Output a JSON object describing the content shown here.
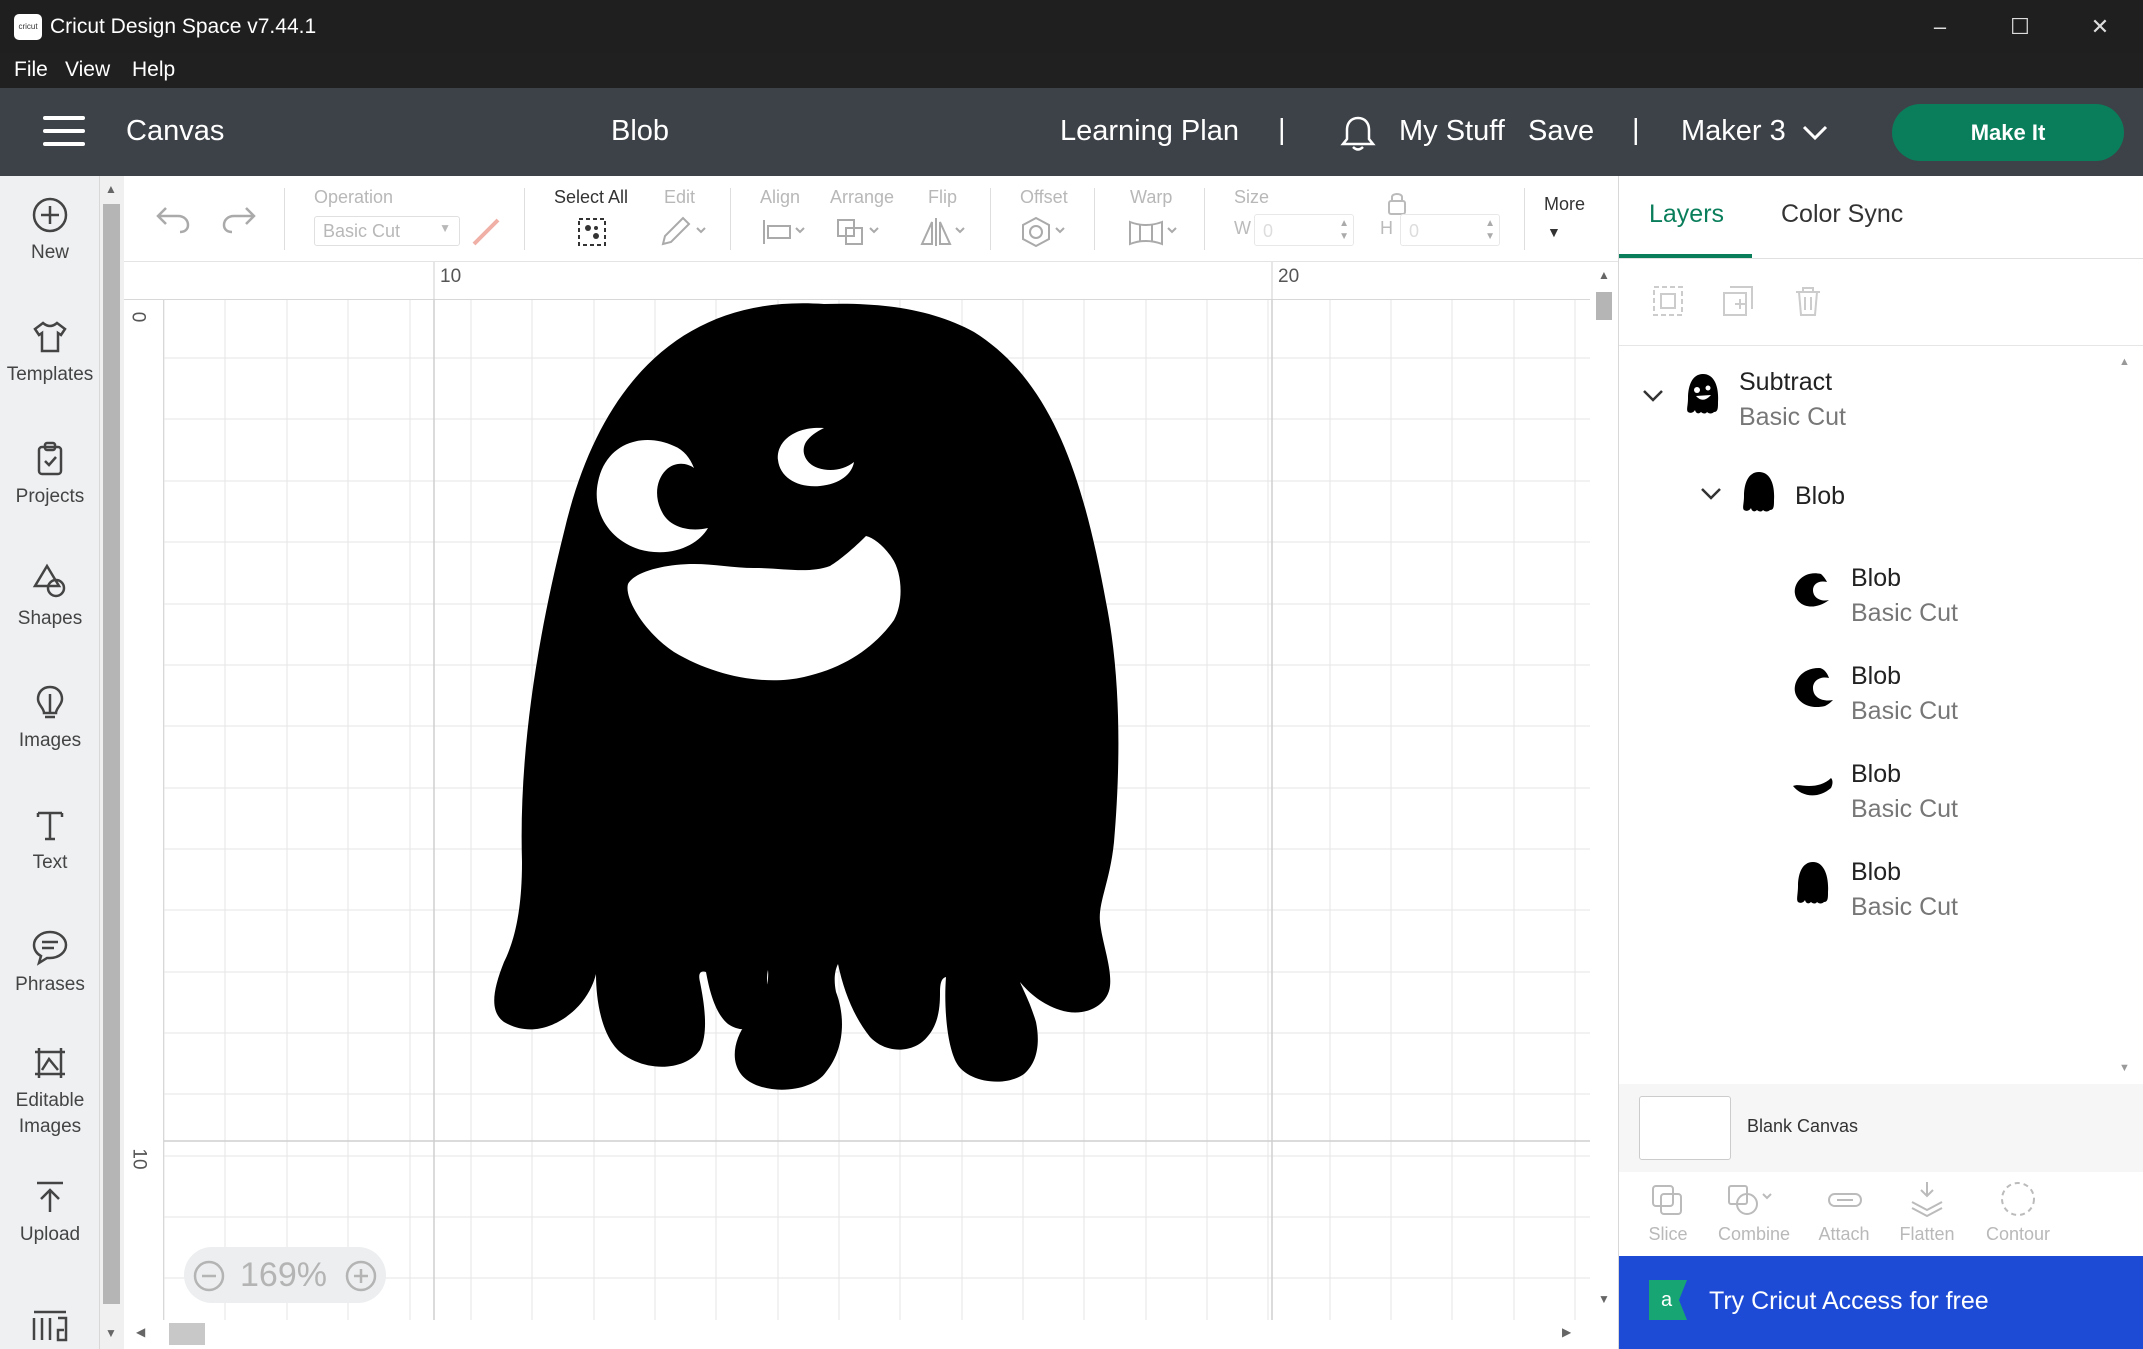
{
  "app": {
    "title": "Cricut Design Space  v7.44.1",
    "logo_text": "cricut"
  },
  "menu": {
    "items": [
      "File",
      "View",
      "Help"
    ]
  },
  "header": {
    "canvas_label": "Canvas",
    "project_name": "Blob",
    "learning_plan": "Learning Plan",
    "separator": "|",
    "my_stuff": "My Stuff",
    "save": "Save",
    "machine": "Maker 3",
    "make_it": "Make It"
  },
  "left_toolbar": {
    "items": [
      {
        "label": "New",
        "icon": "plus-circle-icon"
      },
      {
        "label": "Templates",
        "icon": "shirt-icon"
      },
      {
        "label": "Projects",
        "icon": "clipboard-icon"
      },
      {
        "label": "Shapes",
        "icon": "shapes-icon"
      },
      {
        "label": "Images",
        "icon": "lightbulb-icon"
      },
      {
        "label": "Text",
        "icon": "text-icon"
      },
      {
        "label": "Phrases",
        "icon": "speech-bubble-icon"
      },
      {
        "label": "Editable Images",
        "icon": "editable-image-icon"
      },
      {
        "label": "Upload",
        "icon": "upload-icon"
      }
    ]
  },
  "edit_toolbar": {
    "operation_label": "Operation",
    "operation_value": "Basic Cut",
    "select_all": "Select All",
    "edit": "Edit",
    "align": "Align",
    "arrange": "Arrange",
    "flip": "Flip",
    "offset": "Offset",
    "warp": "Warp",
    "size": "Size",
    "w_label": "W",
    "w_value": "0",
    "h_label": "H",
    "h_value": "0",
    "more": "More"
  },
  "canvas": {
    "ruler_top": [
      "10",
      "20"
    ],
    "ruler_left": [
      "0",
      "10"
    ],
    "zoom": "169%",
    "fill_color": "#000000"
  },
  "right_panel": {
    "tabs": [
      "Layers",
      "Color Sync"
    ],
    "active_tab": "Layers",
    "layers": {
      "group": {
        "name": "Subtract",
        "operation": "Basic Cut"
      },
      "subgroup": {
        "name": "Blob"
      },
      "children": [
        {
          "name": "Blob",
          "operation": "Basic Cut",
          "icon": "eye-shape-icon"
        },
        {
          "name": "Blob",
          "operation": "Basic Cut",
          "icon": "eye-shape-icon"
        },
        {
          "name": "Blob",
          "operation": "Basic Cut",
          "icon": "mouth-shape-icon"
        },
        {
          "name": "Blob",
          "operation": "Basic Cut",
          "icon": "blob-shape-icon"
        }
      ]
    },
    "blank_canvas": "Blank Canvas",
    "bottom_tools": [
      "Slice",
      "Combine",
      "Attach",
      "Flatten",
      "Contour"
    ],
    "banner": "Try Cricut Access for free",
    "accent": "#0a7e5b",
    "banner_color": "#1d4bd6"
  }
}
